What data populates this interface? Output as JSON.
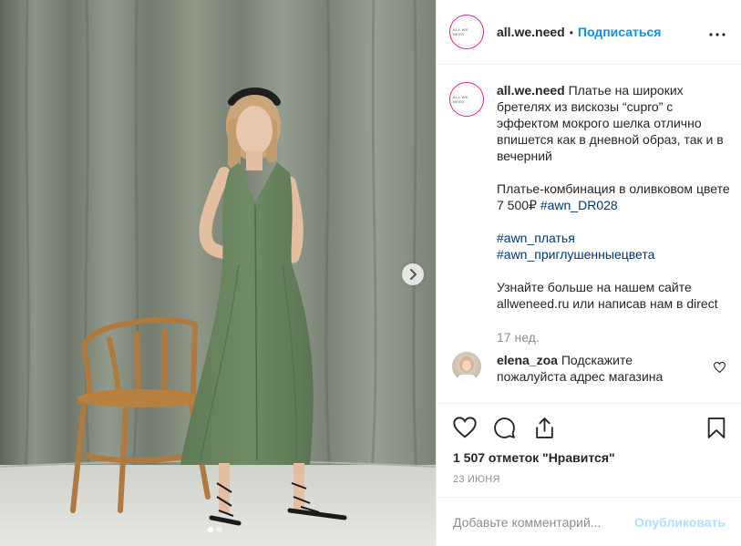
{
  "post": {
    "photo_alt": "Woman in olive green dress next to bentwood chair",
    "carousel_dot_count": 2,
    "carousel_active_index": 0
  },
  "header": {
    "avatar_text": "ALL WE NEED",
    "username": "all.we.need",
    "bullet": "•",
    "follow_label": "Подписаться",
    "more_label": "•••"
  },
  "caption": {
    "avatar_text": "ALL WE NEED",
    "username": "all.we.need",
    "line1": " Платье на широких бретелях из вискозы “cupro” с эффектом мокрого шелка отлично впишется как в дневной образ, так и в вечерний",
    "line2_text": "Платье-комбинация в оливковом цвете 7 500₽ ",
    "line2_tag": "#awn_DR028",
    "tag1": "#awn_платья",
    "tag2": "#awn_приглушенныецвета",
    "line4": "Узнайте больше на нашем сайте allweneed.ru или написав нам в direct",
    "time": "17 нед."
  },
  "comment": {
    "username": "elena_zoa",
    "text": " Подскажите пожалуйста адрес магазина"
  },
  "actions": {
    "likes": "1 507 отметок \"Нравится\"",
    "date": "23 ИЮНЯ"
  },
  "add_comment": {
    "placeholder": "Добавьте комментарий...",
    "publish_label": "Опубликовать"
  },
  "colors": {
    "follow": "#0095f6",
    "hashtag": "#00376b",
    "publish_disabled": "#b2dffc",
    "muted": "#8e8e8e"
  },
  "icons": [
    "chevron-right-icon",
    "more-icon",
    "heart-icon",
    "comment-icon",
    "share-icon",
    "bookmark-icon",
    "small-heart-icon"
  ]
}
